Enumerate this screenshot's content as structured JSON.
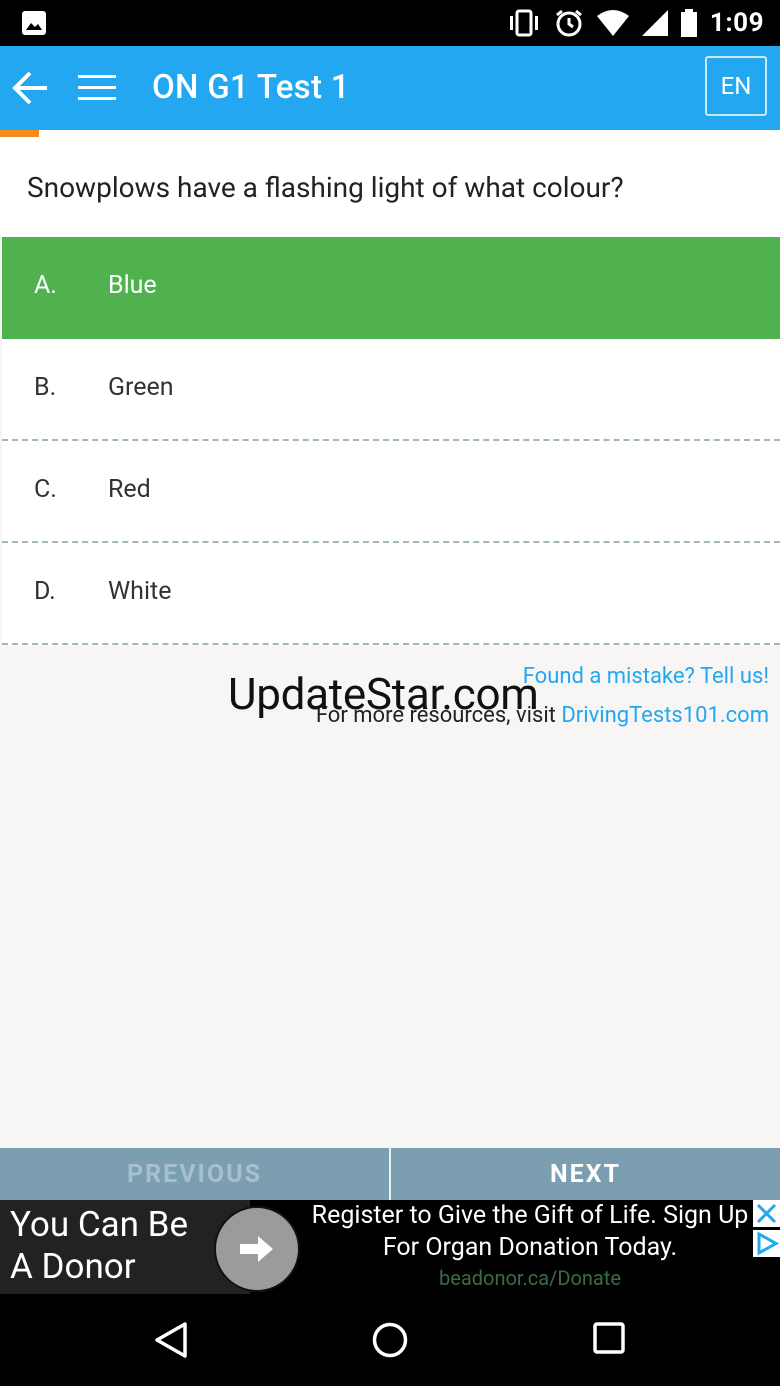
{
  "status_bar": {
    "time": "1:09"
  },
  "app_bar": {
    "title": "ON G1 Test 1",
    "language": "EN"
  },
  "progress": {
    "fraction": 0.05,
    "color": "#f28c1e"
  },
  "question": {
    "text": "Snowplows have a flashing light of what colour?"
  },
  "answers": [
    {
      "letter": "A.",
      "text": "Blue",
      "state": "correct"
    },
    {
      "letter": "B.",
      "text": "Green",
      "state": "default"
    },
    {
      "letter": "C.",
      "text": "Red",
      "state": "default"
    },
    {
      "letter": "D.",
      "text": "White",
      "state": "default"
    }
  ],
  "feedback_link": "Found a mistake? Tell us!",
  "resources": {
    "lead": "For more resources, visit",
    "link": "DrivingTests101.com"
  },
  "watermark": "UpdateStar.com",
  "nav": {
    "previous": "PREVIOUS",
    "next": "NEXT"
  },
  "ad": {
    "headline": "You Can Be A Donor",
    "body": "Register to Give the Gift of Life. Sign Up For Organ Donation Today.",
    "url": "beadonor.ca/Donate"
  },
  "colors": {
    "accent": "#22a7f0",
    "correct": "#4fb24f",
    "nav_bar": "#7b9fb0"
  }
}
